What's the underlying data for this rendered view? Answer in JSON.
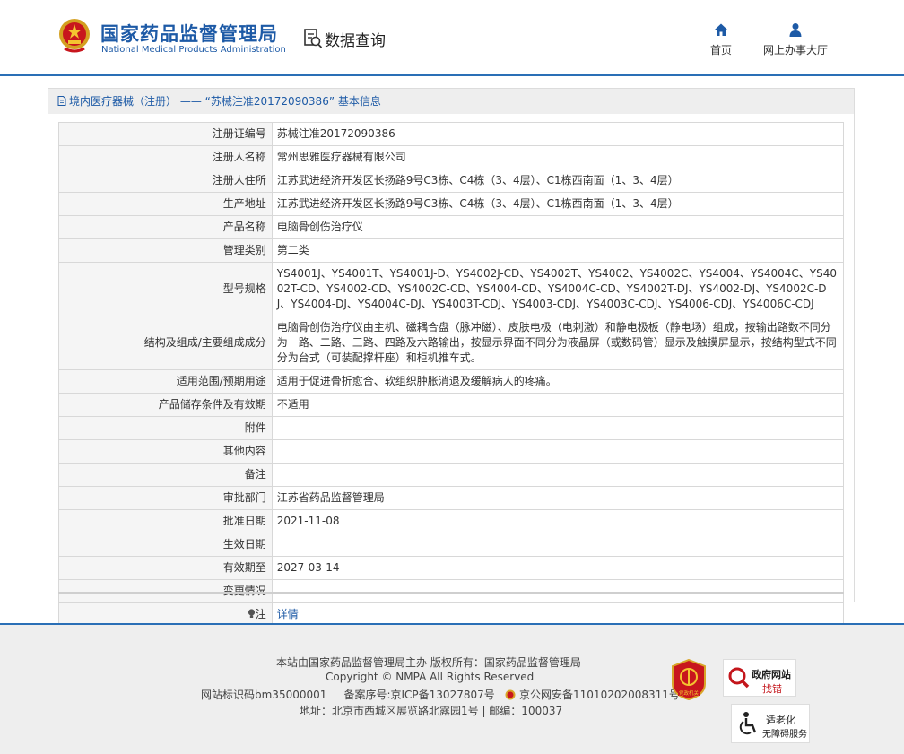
{
  "header": {
    "logo_cn": "国家药品监督管理局",
    "logo_en": "National Medical Products Administration",
    "data_query": "数据查询",
    "nav": {
      "home": "首页",
      "online_hall": "网上办事大厅"
    }
  },
  "breadcrumb": "境内医疗器械（注册） —— “苏械注准20172090386” 基本信息",
  "fields": [
    {
      "label": "注册证编号",
      "value": "苏械注准20172090386"
    },
    {
      "label": "注册人名称",
      "value": "常州思雅医疗器械有限公司"
    },
    {
      "label": "注册人住所",
      "value": "江苏武进经济开发区长扬路9号C3栋、C4栋（3、4层）、C1栋西南面（1、3、4层）"
    },
    {
      "label": "生产地址",
      "value": "江苏武进经济开发区长扬路9号C3栋、C4栋（3、4层）、C1栋西南面（1、3、4层）"
    },
    {
      "label": "产品名称",
      "value": "电脑骨创伤治疗仪"
    },
    {
      "label": "管理类别",
      "value": "第二类"
    },
    {
      "label": "型号规格",
      "value": "YS4001J、YS4001T、YS4001J-D、YS4002J-CD、YS4002T、YS4002、YS4002C、YS4004、YS4004C、YS4002T-CD、YS4002-CD、YS4002C-CD、YS4004-CD、YS4004C-CD、YS4002T-DJ、YS4002-DJ、YS4002C-DJ、YS4004-DJ、YS4004C-DJ、YS4003T-CDJ、YS4003-CDJ、YS4003C-CDJ、YS4006-CDJ、YS4006C-CDJ"
    },
    {
      "label": "结构及组成/主要组成成分",
      "value": "电脑骨创伤治疗仪由主机、磁耦合盘（脉冲磁）、皮肤电极（电刺激）和静电极板（静电场）组成，按输出路数不同分为一路、二路、三路、四路及六路输出，按显示界面不同分为液晶屏（或数码管）显示及触摸屏显示，按结构型式不同分为台式（可装配撑杆座）和柜机推车式。"
    },
    {
      "label": "适用范围/预期用途",
      "value": "适用于促进骨折愈合、软组织肿胀消退及缓解病人的疼痛。"
    },
    {
      "label": "产品储存条件及有效期",
      "value": "不适用"
    },
    {
      "label": "附件",
      "value": ""
    },
    {
      "label": "其他内容",
      "value": ""
    },
    {
      "label": "备注",
      "value": ""
    },
    {
      "label": "审批部门",
      "value": "江苏省药品监督管理局"
    },
    {
      "label": "批准日期",
      "value": "2021-11-08"
    },
    {
      "label": "生效日期",
      "value": ""
    },
    {
      "label": "有效期至",
      "value": "2027-03-14"
    },
    {
      "label": "变更情况",
      "value": ""
    }
  ],
  "note_row": {
    "label": "注",
    "link": "详情"
  },
  "footer": {
    "line1": "本站由国家药品监督管理局主办 版权所有：国家药品监督管理局",
    "line2": "Copyright © NMPA All Rights Reserved",
    "site_id": "网站标识码bm35000001",
    "icp": "备案序号:京ICP备13027807号",
    "police": "京公网安备11010202008311号",
    "address": "地址：北京市西城区展览路北露园1号 | 邮编：100037",
    "badge_red_text": "党政机关",
    "badge_gov": {
      "title": "政府网站",
      "sub": "找错"
    },
    "badge_age": {
      "title": "适老化",
      "sub": "无障碍服务"
    }
  },
  "colors": {
    "brand_blue": "#1d5aa6",
    "header_line": "#2a6fb6",
    "label_bg": "#f5f5f5",
    "footer_bg": "#eeeeee",
    "accent_red": "#c4161c"
  },
  "icons": [
    "national-emblem-icon",
    "data-query-icon",
    "home-icon",
    "user-icon",
    "document-icon",
    "bulb-icon",
    "police-badge-icon",
    "gov-badge-icon",
    "gov-error-icon",
    "accessibility-icon"
  ]
}
